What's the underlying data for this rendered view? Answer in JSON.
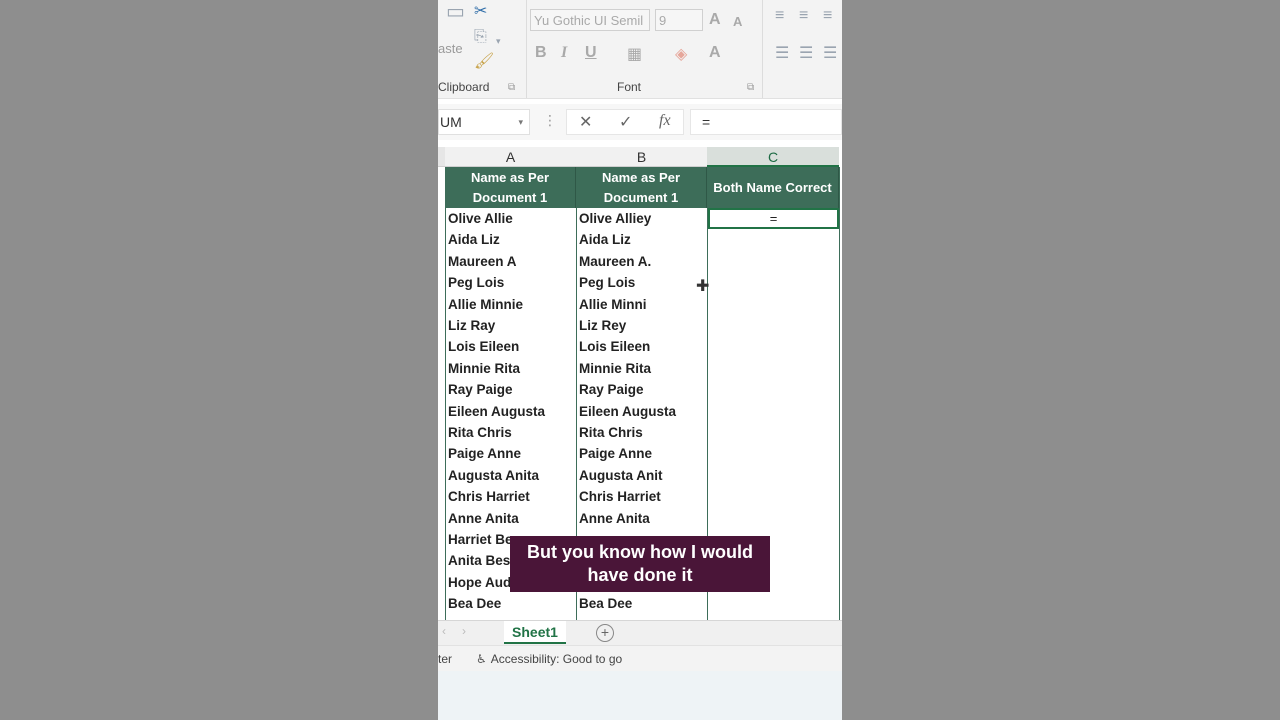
{
  "ribbon": {
    "clipboard": {
      "paste_label": "aste",
      "group_label": "Clipboard"
    },
    "font": {
      "font_name": "Yu Gothic UI Semil",
      "font_size": "9",
      "group_label": "Font",
      "bold": "B",
      "italic": "I",
      "underline": "U",
      "grow": "A",
      "shrink": "A",
      "font_color": "A"
    }
  },
  "formula_bar": {
    "name_box": "UM",
    "cancel": "✕",
    "enter": "✓",
    "fx": "fx",
    "value": "="
  },
  "grid": {
    "columns": [
      "A",
      "B",
      "C"
    ],
    "headers": [
      "Name as Per Document 1",
      "Name as Per Document 1",
      "Both Name Correct"
    ],
    "active_cell_value": "=",
    "rows": [
      [
        "Olive Allie",
        "Olive Alliey"
      ],
      [
        "Aida Liz",
        "Aida Liz"
      ],
      [
        "Maureen A",
        "Maureen A."
      ],
      [
        "Peg Lois",
        "Peg Lois"
      ],
      [
        "Allie Minnie",
        "Allie Minni"
      ],
      [
        "Liz Ray",
        "Liz Rey"
      ],
      [
        "Lois Eileen",
        "Lois Eileen"
      ],
      [
        "Minnie Rita",
        "Minnie Rita"
      ],
      [
        "Ray Paige",
        "Ray Paige"
      ],
      [
        "Eileen Augusta",
        "Eileen Augusta"
      ],
      [
        "Rita Chris",
        "Rita Chris"
      ],
      [
        "Paige Anne",
        "Paige Anne"
      ],
      [
        "Augusta Anita",
        "Augusta Anit"
      ],
      [
        "Chris Harriet",
        "Chris Harriet"
      ],
      [
        "Anne Anita",
        "Anne Anita"
      ],
      [
        "Harriet Be",
        ""
      ],
      [
        "Anita Bess",
        ""
      ],
      [
        "Hope Aud",
        ""
      ],
      [
        "Bea Dee",
        "Bea Dee"
      ]
    ]
  },
  "sheet_tabs": {
    "active": "Sheet1",
    "add": "+"
  },
  "status_bar": {
    "left": "ter",
    "accessibility": "Accessibility: Good to go"
  },
  "subtitle": {
    "line1": "But you know how I would",
    "line2": "have done it"
  },
  "colors": {
    "header_green": "#3d6d59",
    "excel_green": "#217346",
    "subtitle_bg": "#4a1538"
  }
}
